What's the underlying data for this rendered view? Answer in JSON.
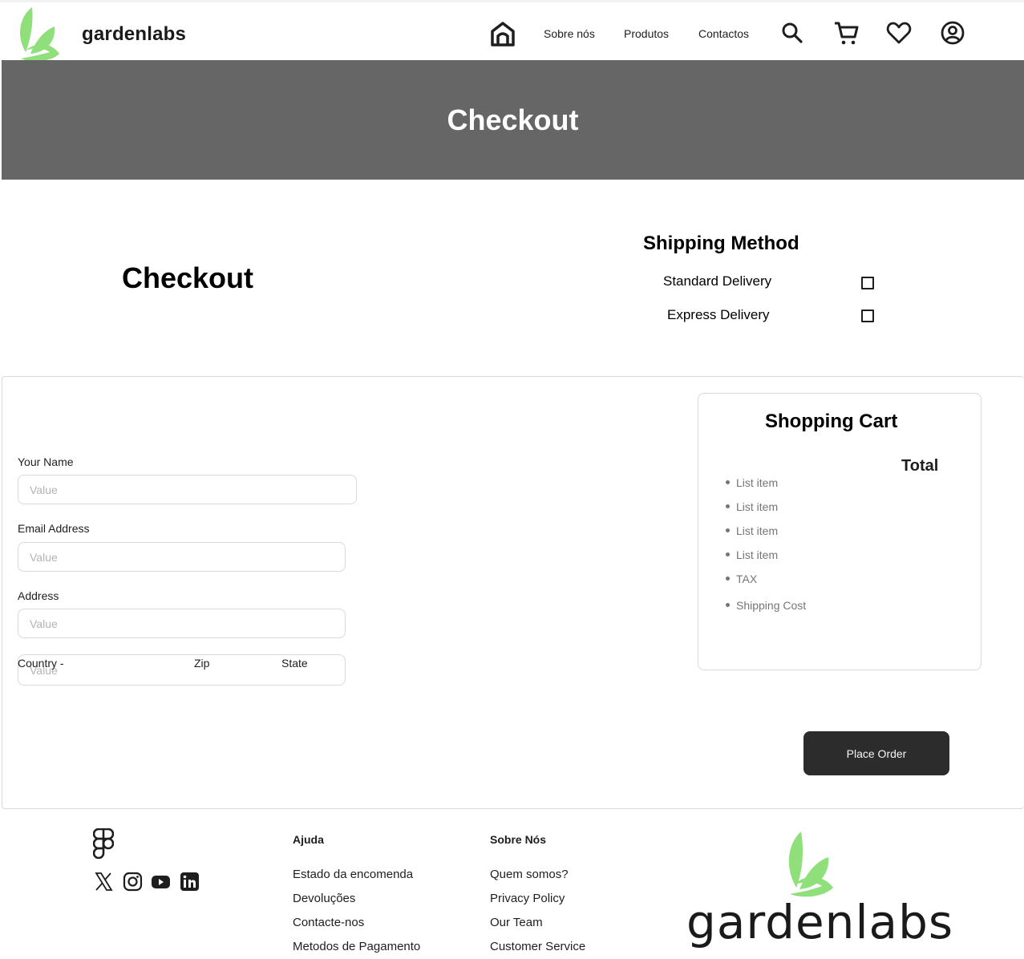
{
  "header": {
    "brand": "gardenlabs",
    "nav": [
      "Sobre nós",
      "Produtos",
      "Contactos"
    ],
    "icons": [
      "home-icon",
      "search-icon",
      "cart-icon",
      "heart-icon",
      "account-icon"
    ]
  },
  "hero": {
    "title": "Checkout"
  },
  "checkout": {
    "title": "Checkout",
    "shipping": {
      "title": "Shipping Method",
      "options": [
        "Standard Delivery",
        "Express Delivery"
      ]
    }
  },
  "form": {
    "name_label": "Your Name",
    "name_placeholder": "Value",
    "email_label": "Email Address",
    "email_placeholder": "Value",
    "address_label": "Address",
    "address_placeholder": "Value",
    "country_label": "Country -",
    "zip_label": "Zip",
    "state_label": "State",
    "country_placeholder": "Value"
  },
  "cart": {
    "title": "Shopping Cart",
    "total_label": "Total",
    "items": [
      "List item",
      "List item",
      "List item",
      "List item",
      "TAX",
      "Shipping Cost"
    ]
  },
  "order_button": "Place Order",
  "footer": {
    "help": {
      "title": "Ajuda",
      "links": [
        "Estado da encomenda",
        "Devoluções",
        "Contacte-nos",
        "Metodos de Pagamento"
      ]
    },
    "about": {
      "title": "Sobre Nós",
      "links": [
        "Quem somos?",
        "Privacy Policy",
        "Our Team",
        "Customer Service"
      ]
    },
    "brand": "gardenlabs",
    "social": [
      "x-icon",
      "instagram-icon",
      "youtube-icon",
      "linkedin-icon"
    ]
  },
  "colors": {
    "hero_bg": "#666666",
    "leaf_green": "#8fe07a",
    "button_bg": "#2c2c2c"
  }
}
